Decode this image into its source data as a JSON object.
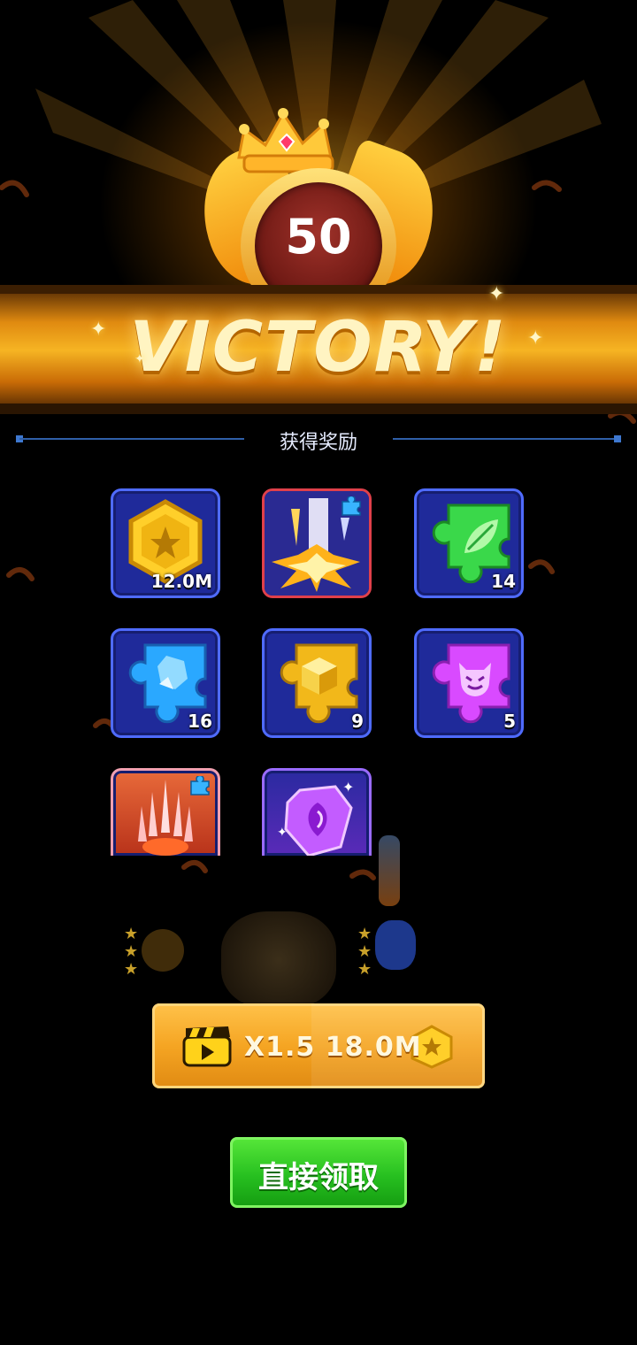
{
  "result": {
    "level": "50",
    "title": "VICTORY!"
  },
  "rewards": {
    "section_title": "获得奖励",
    "items": [
      {
        "icon": "gold-coin-icon",
        "count": "12.0M"
      },
      {
        "icon": "laser-strike-icon",
        "count": ""
      },
      {
        "icon": "green-leaf-puzzle-icon",
        "count": "14"
      },
      {
        "icon": "blue-crystal-puzzle-icon",
        "count": "16"
      },
      {
        "icon": "gold-box-puzzle-icon",
        "count": "9"
      },
      {
        "icon": "purple-demon-puzzle-icon",
        "count": "5"
      },
      {
        "icon": "red-spike-weapon-icon",
        "count": ""
      },
      {
        "icon": "purple-gem-icon",
        "count": ""
      }
    ]
  },
  "actions": {
    "ad_multiplier_label": "X1.5 18.0M",
    "claim_label": "直接领取"
  },
  "colors": {
    "banner": "#f6b423",
    "tile_bg": "#1f2a9a",
    "tile_border": "#4f6bff",
    "ad_button": "#f5a523",
    "claim_button": "#27c020"
  }
}
